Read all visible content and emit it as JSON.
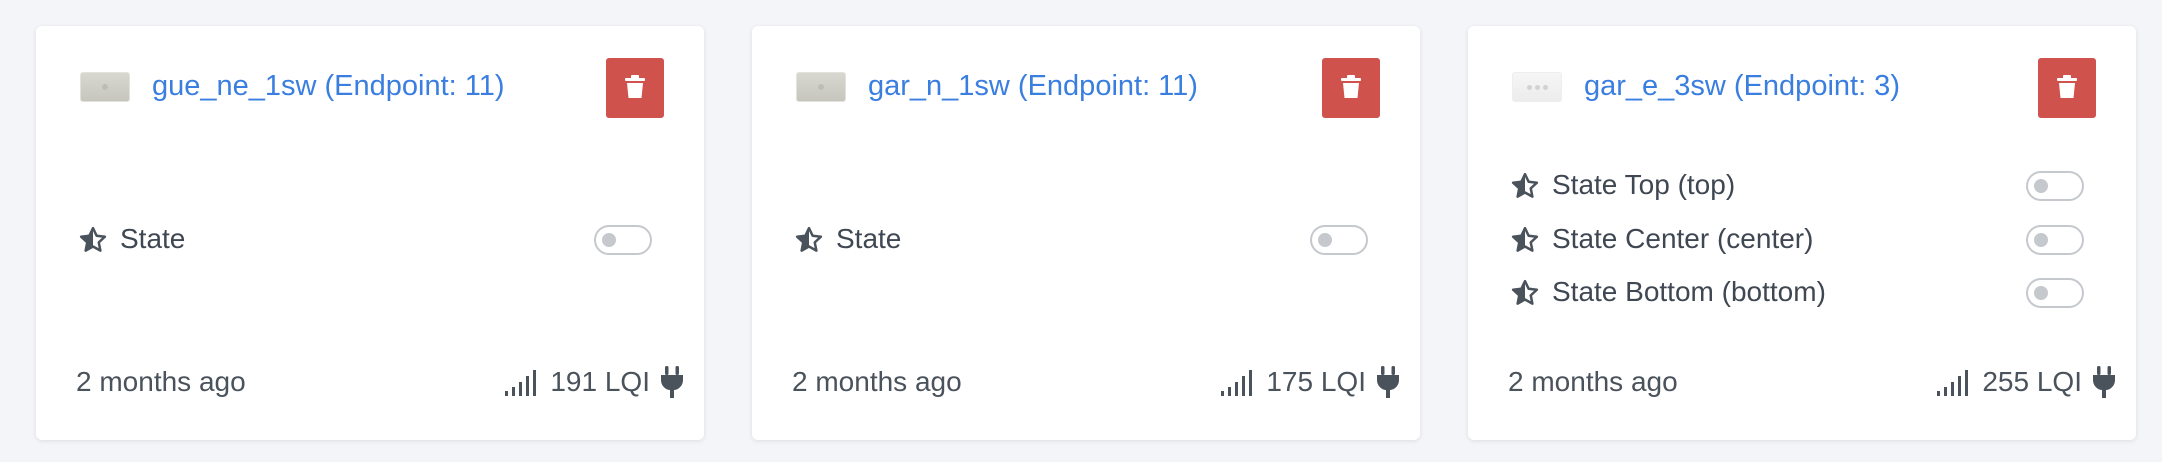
{
  "cards": [
    {
      "title": "gue_ne_1sw (Endpoint: 11)",
      "thumbnail": "switch-1-gang",
      "delete_icon": "trash-icon",
      "states": [
        {
          "label": "State",
          "on": false
        }
      ],
      "last_seen": "2 months ago",
      "lqi": "191 LQI",
      "power_icon": "plug-icon"
    },
    {
      "title": "gar_n_1sw (Endpoint: 11)",
      "thumbnail": "switch-1-gang",
      "delete_icon": "trash-icon",
      "states": [
        {
          "label": "State",
          "on": false
        }
      ],
      "last_seen": "2 months ago",
      "lqi": "175 LQI",
      "power_icon": "plug-icon"
    },
    {
      "title": "gar_e_3sw (Endpoint: 3)",
      "thumbnail": "switch-3-gang",
      "delete_icon": "trash-icon",
      "states": [
        {
          "label": "State Top (top)",
          "on": false
        },
        {
          "label": "State Center (center)",
          "on": false
        },
        {
          "label": "State Bottom (bottom)",
          "on": false
        }
      ],
      "last_seen": "2 months ago",
      "lqi": "255 LQI",
      "power_icon": "plug-icon"
    }
  ],
  "colors": {
    "link": "#3a7ee0",
    "delete_button": "#cf534c",
    "text": "#3f4752",
    "toggle_off": "#c5c8cd",
    "background": "#f4f5f8"
  }
}
